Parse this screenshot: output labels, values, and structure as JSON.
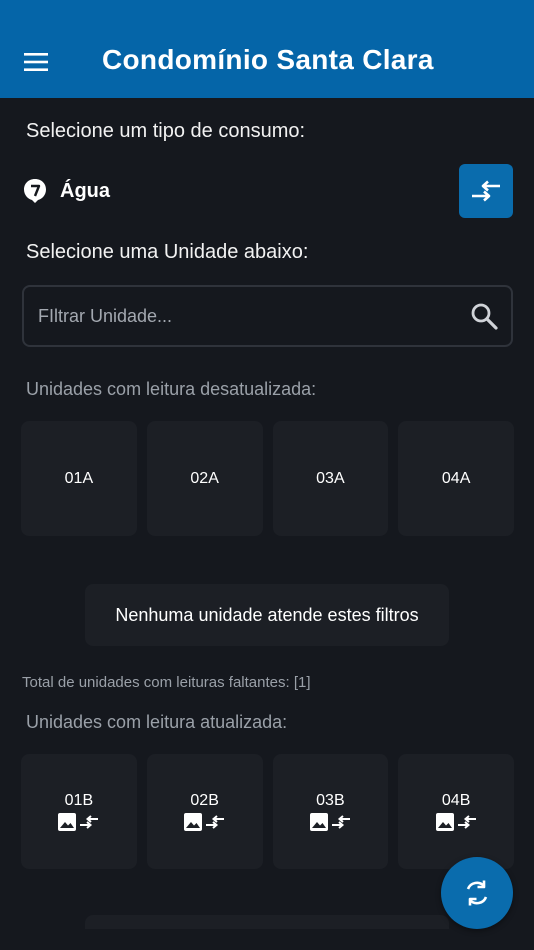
{
  "appbar": {
    "title": "Condomínio Santa Clara",
    "menu_icon": "menu-icon"
  },
  "consumo": {
    "label": "Selecione um tipo de consumo:",
    "selected": "Água",
    "icon": "water-drop-icon",
    "swap_icon": "swap-icon"
  },
  "unidade": {
    "label": "Selecione uma Unidade abaixo:",
    "filter_placeholder": "FIltrar Unidade...",
    "filter_value": ""
  },
  "desatualizadas": {
    "label": "Unidades com leitura desatualizada:",
    "units": [
      "01A",
      "02A",
      "03A",
      "04A"
    ],
    "empty_message": "Nenhuma unidade atende estes filtros",
    "total_text": "Total de unidades com leituras faltantes: [1]"
  },
  "atualizadas": {
    "label": "Unidades com leitura atualizada:",
    "units": [
      "01B",
      "02B",
      "03B",
      "04B"
    ]
  },
  "fab": {
    "icon": "refresh-icon"
  },
  "colors": {
    "appbar": "#0565a8",
    "accent": "#0a6cad",
    "background": "#15181e",
    "tile": "#1c1f25"
  }
}
